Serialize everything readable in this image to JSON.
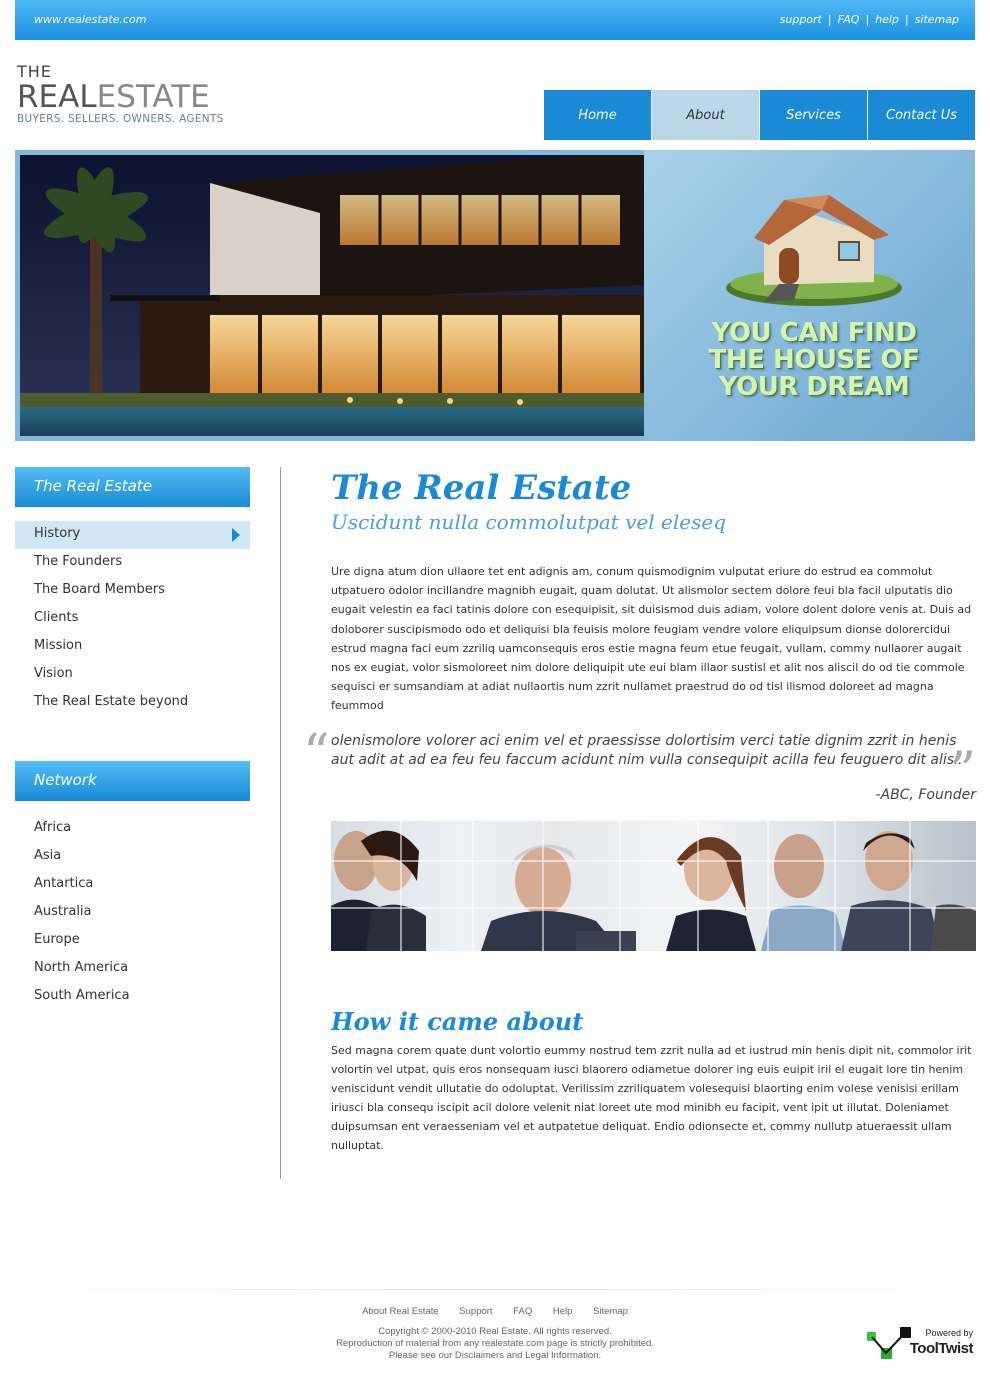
{
  "header": {
    "site_url": "www.realestate.com",
    "links": [
      "support",
      "FAQ",
      "help",
      "sitemap"
    ]
  },
  "logo": {
    "the": "THE",
    "real": "REAL",
    "estate": "ESTATE",
    "tagline": "BUYERS. SELLERS. OWNERS. AGENTS"
  },
  "nav": {
    "items": [
      "Home",
      "About",
      "Services",
      "Contact Us"
    ],
    "active": "About"
  },
  "banner": {
    "slogan_lines": [
      "YOU CAN FIND",
      "THE HOUSE OF",
      "YOUR DREAM"
    ]
  },
  "sidebar": {
    "section1_title": "The Real Estate",
    "section1_items": [
      "History",
      "The Founders",
      "The Board Members",
      "Clients",
      "Mission",
      "Vision",
      "The Real Estate beyond"
    ],
    "section1_active": "History",
    "section2_title": "Network",
    "section2_items": [
      "Africa",
      "Asia",
      "Antartica",
      "Australia",
      "Europe",
      "North America",
      "South America"
    ]
  },
  "content": {
    "title": "The Real Estate",
    "subtitle": "Uscidunt nulla commolutpat vel eleseq",
    "paragraph1": "Ure digna atum dion ullaore tet ent adignis am, conum quismodignim vulputat eriure do estrud ea commolut utpatuero odolor incillandre magnibh eugait, quam dolutat. Ut alismolor sectem dolore feui bla facil ulputatis dio eugait velestin ea faci tatinis dolore con esequipisit, sit duisismod duis adiam, volore dolent dolore venis at. Duis ad doloborer suscipismodo odo et deliquisi bla feuisis molore feugiam vendre volore eliquipsum dionse dolorercidui estrud magna faci eum zzriliq uamconsequis eros estie magna feum etue feugait, vullam, commy nullaorer augait nos ex eugiat, volor sismoloreet nim dolore deliquipit ute eui blam illaor sustisl et alit nos aliscil do od tie commole sequisci er sumsandiam at adiat nullaortis num zzrit nullamet praestrud do od tisl ilismod doloreet ad magna feummod",
    "quote": "olenismolore volorer aci enim vel et praessisse dolortisim verci tatie dignim zzrit in henis aut adit at ad ea feu feu faccum acidunt nim vulla consequipit acilla feu feuguero dit alisi.",
    "quote_author": "-ABC, Founder",
    "section_title": "How it came about",
    "paragraph2": "Sed magna corem quate dunt volortio eummy nostrud tem zzrit nulla ad et iustrud min henis dipit nit, commolor irit volortin vel utpat, quis eros nonsequam iusci blaorero odiametue dolorer ing euis euipit iril el eugait lore tin henim veniscidunt vendit ullutatie do odoluptat. Verilissim zzriliquatem volesequisi blaorting enim volese venisisi erillam iriusci bla consequ iscipit acil dolore velenit niat loreet ute mod minibh eu facipit, vent ipit ut illutat. Doleniamet duipsumsan ent veraesseniam vel et autpatetue deliquat. Endio odionsecte et, commy nullutp atueraessit ullam nulluptat."
  },
  "footer": {
    "links": [
      "About Real Estate",
      "Support",
      "FAQ",
      "Help",
      "Sitemap"
    ],
    "copyright": "Copyright © 2000-2010 Real Estate. All rights reserved.",
    "reproduction": "Reproduction of material from any realestate.com page is strictly prohibited.",
    "disclaimer": "Please see our Disclaimers and Legal Information.",
    "powered_by": "Powered by",
    "powered_name": "ToolTwist"
  },
  "colors": {
    "accent": "#1a8ad6",
    "nav_active": "#bcd7ea"
  }
}
